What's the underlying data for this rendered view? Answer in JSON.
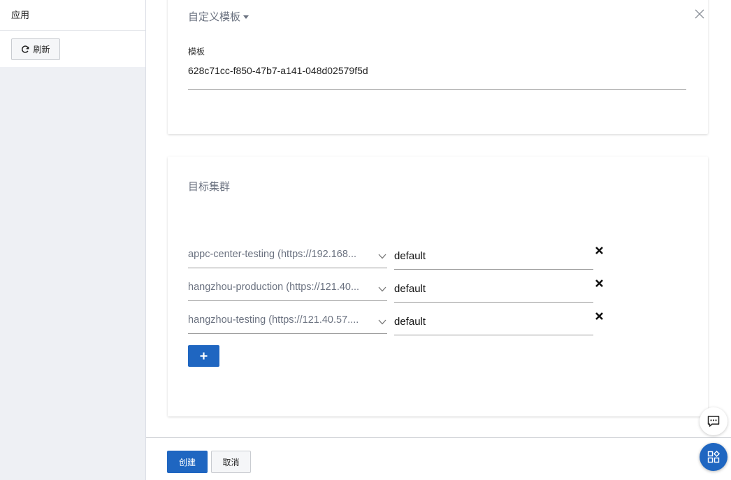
{
  "sidebar": {
    "title": "应用",
    "refresh_label": "刷新"
  },
  "template_card": {
    "template_type": "自定义模板",
    "field_label": "模板",
    "field_value": "628c71cc-f850-47b7-a141-048d02579f5d"
  },
  "target_card": {
    "title": "目标集群",
    "rows": [
      {
        "cluster": "appc-center-testing (https://192.168...",
        "namespace": "default"
      },
      {
        "cluster": "hangzhou-production (https://121.40...",
        "namespace": "default"
      },
      {
        "cluster": "hangzhou-testing (https://121.40.57....",
        "namespace": "default"
      }
    ]
  },
  "footer": {
    "create_label": "创建",
    "cancel_label": "取消"
  },
  "colors": {
    "primary": "#1f66c1",
    "sidebar_bg": "#eef0f4",
    "muted_text": "#6b7280"
  },
  "icons": [
    "refresh-icon",
    "caret-down-icon",
    "close-icon",
    "chevron-down-icon",
    "remove-icon",
    "plus-icon",
    "chat-icon",
    "apps-icon"
  ]
}
